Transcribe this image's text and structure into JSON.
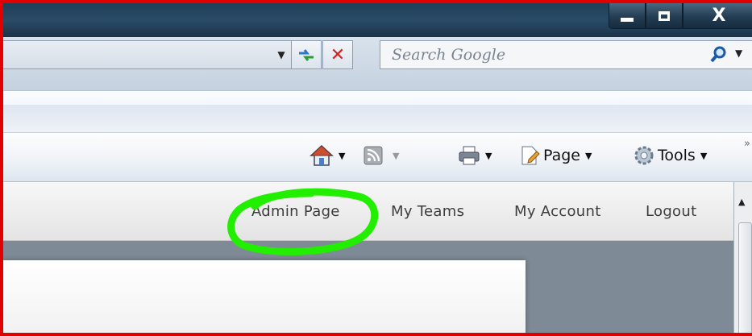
{
  "window_controls": {
    "minimize_icon": "minimize-icon",
    "maximize_icon": "maximize-icon",
    "close_label": "X"
  },
  "address_bar": {
    "dropdown_icon": "chevron-down-icon",
    "refresh_icon": "refresh-icon",
    "stop_label": "✕"
  },
  "search": {
    "placeholder": "Search Google",
    "icon": "magnifier-icon",
    "dropdown_icon": "chevron-down-icon"
  },
  "command_bar": {
    "items": [
      {
        "icon": "home-icon"
      },
      {
        "icon": "feeds-icon"
      },
      {
        "icon": "print-icon"
      },
      {
        "icon": "page-icon",
        "label": "Page"
      },
      {
        "icon": "tools-gear-icon",
        "label": "Tools"
      }
    ],
    "overflow_label": "»"
  },
  "site_nav": {
    "links": [
      "Admin Page",
      "My Teams",
      "My Account",
      "Logout"
    ],
    "highlight_color": "#22ee00"
  },
  "colors": {
    "frame_border": "#e00000",
    "titlebar": "#1f3f58",
    "content_bg": "#7e8a95"
  }
}
